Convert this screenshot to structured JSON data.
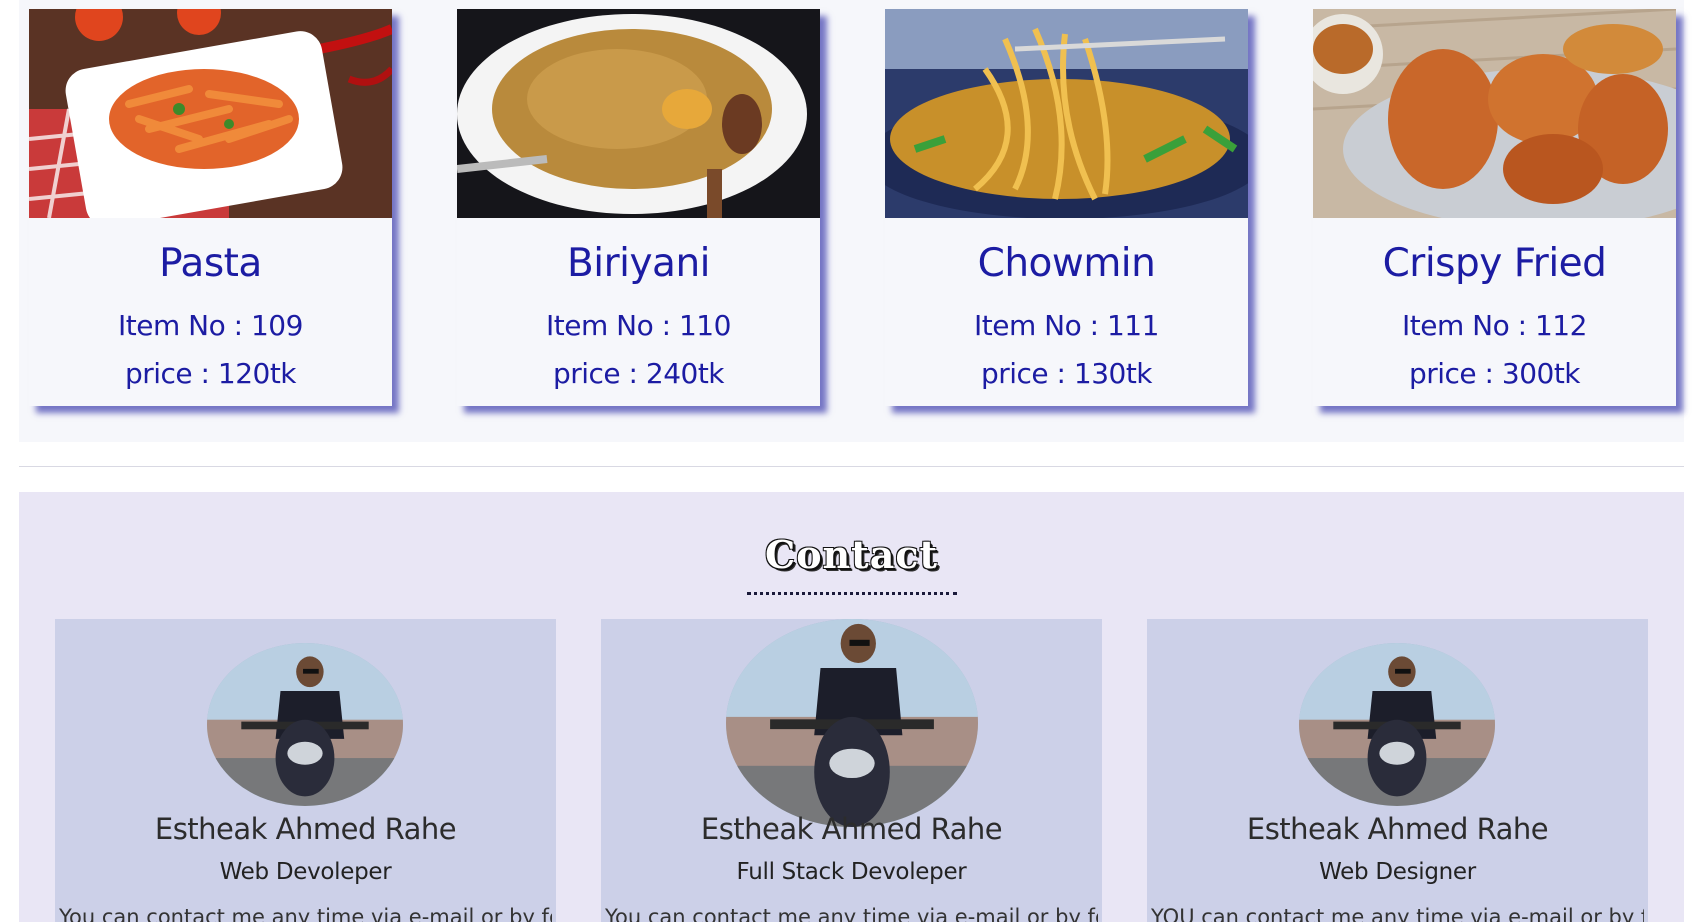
{
  "foods": [
    {
      "name": "Pasta",
      "item_no": "Item No : 109",
      "price": "price : 120tk",
      "image": "pasta-photo"
    },
    {
      "name": "Biriyani",
      "item_no": "Item No : 110",
      "price": "price : 240tk",
      "image": "biriyani-photo"
    },
    {
      "name": "Chowmin",
      "item_no": "Item No : 111",
      "price": "price : 130tk",
      "image": "chowmin-photo"
    },
    {
      "name": "Crispy Fried",
      "item_no": "Item No : 112",
      "price": "price : 300tk",
      "image": "fried-chicken-photo"
    }
  ],
  "contact": {
    "heading": "Contact",
    "profiles": [
      {
        "name": "Estheak Ahmed Rahe",
        "role": "Web Devoleper",
        "desc": "You can contact me any time via e-mail or by form"
      },
      {
        "name": "Estheak Ahmed Rahe",
        "role": "Full Stack Devoleper",
        "desc": "You can contact me any time via e-mail or by form"
      },
      {
        "name": "Estheak Ahmed Rahe",
        "role": "Web Designer",
        "desc": "YOU can contact me any time via e-mail or by form"
      }
    ]
  },
  "colors": {
    "accent_text": "#1c1ca3",
    "card_shadow": "#3434b0",
    "contact_bg": "#e9e6f5",
    "profile_card_bg": "#ccd0e8"
  }
}
